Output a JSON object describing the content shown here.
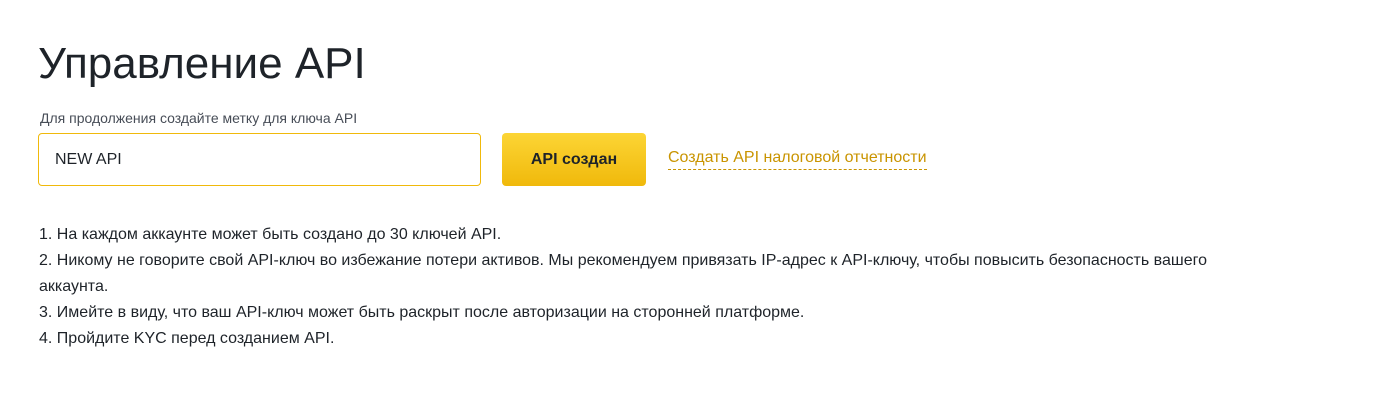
{
  "page": {
    "title": "Управление API"
  },
  "form": {
    "label": "Для продолжения создайте метку для ключа API",
    "input_value": "NEW API",
    "create_button": "API создан",
    "tax_link": "Создать API налоговой отчетности"
  },
  "notes": [
    "1. На каждом аккаунте может быть создано до 30 ключей API.",
    "2. Никому не говорите свой API-ключ во избежание потери активов. Мы рекомендуем привязать IP-адрес к API-ключу, чтобы повысить безопасность вашего аккаунта.",
    "3. Имейте в виду, что ваш API-ключ может быть раскрыт после авторизации на сторонней платформе.",
    "4. Пройдите KYC перед созданием API."
  ],
  "colors": {
    "accent": "#f0b90b",
    "link": "#c99400",
    "text": "#1e2329"
  }
}
